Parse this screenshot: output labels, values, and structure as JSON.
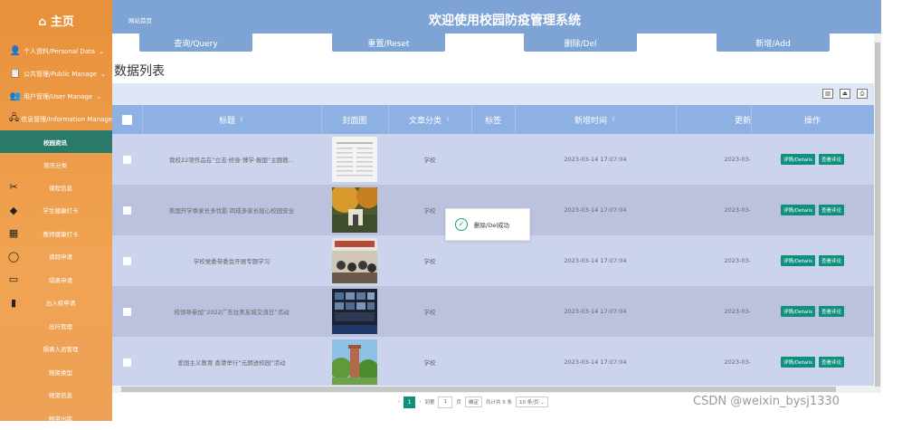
{
  "sidebar": {
    "home": "⌂ 主页",
    "groups": [
      {
        "icon": "👤",
        "label": "个人资料/Personal Data",
        "chev": "⌄"
      },
      {
        "icon": "📋",
        "label": "公共管理/Public Manage",
        "chev": "⌄"
      },
      {
        "icon": "👥",
        "label": "用户管理/User Manage",
        "chev": "⌄"
      },
      {
        "icon": "🖧",
        "label": "信息管理/Information Manage",
        "chev": ""
      }
    ],
    "subitems": [
      "校园资讯",
      "资讯分类"
    ],
    "items": [
      {
        "icon": "✂",
        "label": "课程信息"
      },
      {
        "icon": "◆",
        "label": "学生健康打卡"
      },
      {
        "icon": "▦",
        "label": "教师健康打卡"
      },
      {
        "icon": "◯",
        "label": "请假申请"
      },
      {
        "icon": "▭",
        "label": "隔离申请"
      },
      {
        "icon": "▮",
        "label": "出入校申请"
      },
      {
        "icon": "",
        "label": "出行管理"
      },
      {
        "icon": "",
        "label": "隔离人员管理"
      },
      {
        "icon": "",
        "label": "物资类型"
      },
      {
        "icon": "",
        "label": "物资信息"
      },
      {
        "icon": "",
        "label": "物资出库"
      }
    ]
  },
  "header": {
    "site_name": "网站首页",
    "title": "欢迎使用校园防疫管理系统"
  },
  "actions": {
    "query": "查询/Query",
    "reset": "重置/Reset",
    "del": "删除/Del",
    "add": "新增/Add"
  },
  "list_title": "数据列表",
  "table": {
    "columns": [
      "标题",
      "封面图",
      "文章分类",
      "标签",
      "新增时间",
      "更新",
      "操作"
    ],
    "sort_icon": "⇕",
    "rows": [
      {
        "title": "我校22项作品在“立志·修身·博学·报国”主题教...",
        "category": "学校",
        "tag": "",
        "time": "2023-03-14 17:07:04",
        "updated": "2023-03-"
      },
      {
        "title": "美国开学季家长多忧影 四成多家长担心校园安全",
        "category": "学校",
        "tag": "",
        "time": "2023-03-14 17:07:04",
        "updated": "2023-03-"
      },
      {
        "title": "学校党委带委会开展专题学习",
        "category": "学校",
        "tag": "",
        "time": "2023-03-14 17:07:04",
        "updated": "2023-03-"
      },
      {
        "title": "校领导参加“2022广东拉美友城交流日”活动",
        "category": "学校",
        "tag": "",
        "time": "2023-03-14 17:07:04",
        "updated": "2023-03-"
      },
      {
        "title": "爱国主义教育 香港举行“元朗进校园”活动",
        "category": "学校",
        "tag": "",
        "time": "2023-03-14 17:07:04",
        "updated": "2023-03-"
      }
    ],
    "btn_detail": "详情/Details",
    "btn_comment": "查看评论"
  },
  "pager": {
    "prev": "‹",
    "current": "1",
    "next": "›",
    "goto": "到第",
    "page_input": "1",
    "page_unit": "页",
    "go": "确定",
    "total": "共计共 5 条",
    "per_page": "10 条/页 ⌄"
  },
  "toast": {
    "icon": "✓",
    "message": "删除/Del成功"
  },
  "watermark": "CSDN @weixin_bysj1330"
}
